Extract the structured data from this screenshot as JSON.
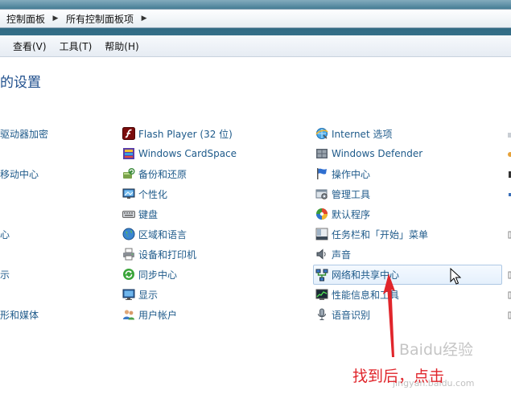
{
  "breadcrumb": {
    "items": [
      "控制面板",
      "所有控制面板项"
    ]
  },
  "menubar": {
    "items": [
      "查看(V)",
      "工具(T)",
      "帮助(H)"
    ]
  },
  "page": {
    "heading": "的设置"
  },
  "columns": [
    {
      "items": [
        {
          "label": "驱动器加密",
          "icon": "none"
        },
        {
          "label": "",
          "icon": "none"
        },
        {
          "label": "移动中心",
          "icon": "none"
        },
        {
          "label": "",
          "icon": "none"
        },
        {
          "label": "",
          "icon": "none"
        },
        {
          "label": "心",
          "icon": "none"
        },
        {
          "label": "",
          "icon": "none"
        },
        {
          "label": "示",
          "icon": "none"
        },
        {
          "label": "",
          "icon": "none"
        },
        {
          "label": "形和媒体",
          "icon": "none"
        }
      ]
    },
    {
      "items": [
        {
          "label": "Flash Player (32 位)",
          "icon": "flash-icon"
        },
        {
          "label": "Windows CardSpace",
          "icon": "cardspace-icon"
        },
        {
          "label": "备份和还原",
          "icon": "backup-icon"
        },
        {
          "label": "个性化",
          "icon": "personalization-icon"
        },
        {
          "label": "键盘",
          "icon": "keyboard-icon"
        },
        {
          "label": "区域和语言",
          "icon": "region-language-icon"
        },
        {
          "label": "设备和打印机",
          "icon": "printer-icon"
        },
        {
          "label": "同步中心",
          "icon": "sync-icon"
        },
        {
          "label": "显示",
          "icon": "display-icon"
        },
        {
          "label": "用户帐户",
          "icon": "user-accounts-icon"
        }
      ]
    },
    {
      "items": [
        {
          "label": "Internet 选项",
          "icon": "internet-options-icon"
        },
        {
          "label": "Windows Defender",
          "icon": "defender-icon"
        },
        {
          "label": "操作中心",
          "icon": "action-center-flag-icon"
        },
        {
          "label": "管理工具",
          "icon": "admin-tools-icon"
        },
        {
          "label": "默认程序",
          "icon": "default-programs-icon"
        },
        {
          "label": "任务栏和「开始」菜单",
          "icon": "taskbar-icon"
        },
        {
          "label": "声音",
          "icon": "speaker-icon"
        },
        {
          "label": "网络和共享中心",
          "icon": "network-icon",
          "highlighted": true
        },
        {
          "label": "性能信息和工具",
          "icon": "performance-icon"
        },
        {
          "label": "语音识别",
          "icon": "microphone-icon"
        }
      ]
    }
  ],
  "annotation": {
    "text": "找到后，点击"
  },
  "watermark": {
    "title": "Baidu经验",
    "url": "jingyan.baidu.com"
  },
  "colors": {
    "link": "#1e5a8a",
    "heading": "#1e4e8c",
    "highlight_border": "#aec8e4",
    "annotation_red": "#e0252b"
  }
}
